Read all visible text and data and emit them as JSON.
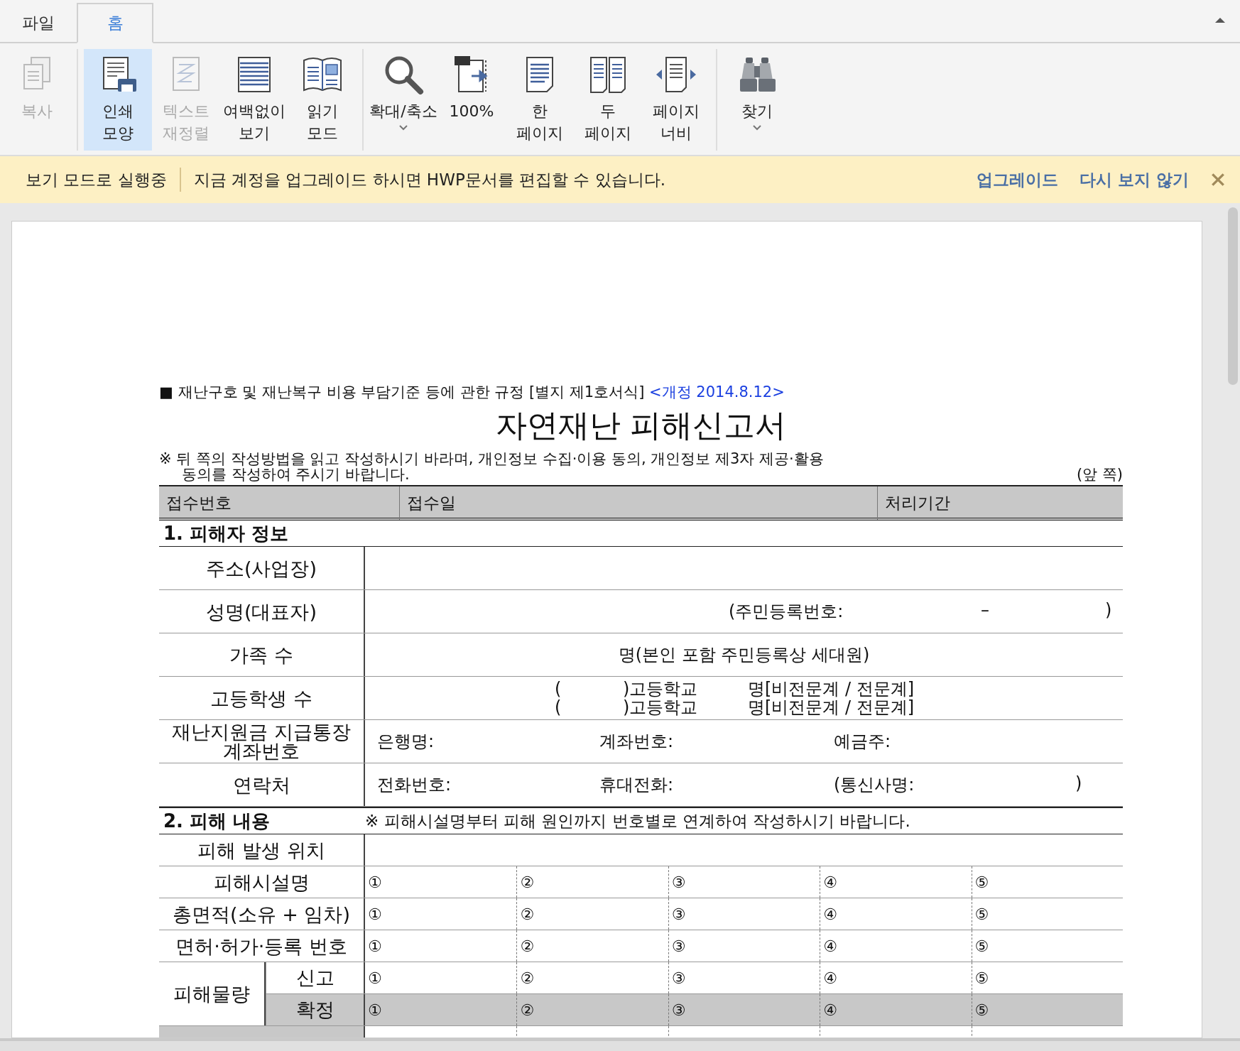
{
  "tabs": [
    {
      "label": "파일",
      "selected": false
    },
    {
      "label": "홈",
      "selected": true
    }
  ],
  "ribbon": {
    "groups": [
      [
        {
          "lines": [
            "복사"
          ],
          "disabled": true,
          "selected": false
        }
      ],
      [
        {
          "lines": [
            "인쇄",
            "모양"
          ],
          "disabled": false,
          "selected": true
        },
        {
          "lines": [
            "텍스트",
            "재정렬"
          ],
          "disabled": true,
          "selected": false
        },
        {
          "lines": [
            "여백없이",
            "보기"
          ],
          "disabled": false,
          "selected": false
        },
        {
          "lines": [
            "읽기",
            "모드"
          ],
          "disabled": false,
          "selected": false
        }
      ],
      [
        {
          "lines": [
            "확대/축소"
          ],
          "disabled": false,
          "selected": false,
          "dropdown": true
        },
        {
          "lines": [
            "100%"
          ],
          "disabled": false,
          "selected": false
        },
        {
          "lines": [
            "한",
            "페이지"
          ],
          "disabled": false,
          "selected": false
        },
        {
          "lines": [
            "두",
            "페이지"
          ],
          "disabled": false,
          "selected": false
        },
        {
          "lines": [
            "페이지",
            "너비"
          ],
          "disabled": false,
          "selected": false
        }
      ],
      [
        {
          "lines": [
            "찾기"
          ],
          "disabled": false,
          "selected": false,
          "dropdown": true
        }
      ]
    ]
  },
  "banner": {
    "mode": "보기 모드로 실행중",
    "message": "지금 계정을 업그레이드 하시면 HWP문서를 편집할 수 있습니다.",
    "links": [
      "업그레이드",
      "다시 보지 않기"
    ]
  },
  "document": {
    "regulation": "■ 재난구호 및 재난복구 비용 부담기준 등에 관한 규정 [별지 제1호서식]",
    "revision": "<개정 2014.8.12>",
    "title": "자연재난 피해신고서",
    "notice_lines": [
      "※ 뒤 쪽의 작성방법을 읽고 작성하시기 바라며, 개인정보 수집·이용 동의, 개인정보 제3자 제공·활용",
      "동의를 작성하여 주시기 바랍니다."
    ],
    "page_side": "(앞 쪽)",
    "receipt_header": [
      "접수번호",
      "접수일",
      "처리기간"
    ],
    "section1": {
      "title": "1. 피해자 정보",
      "rows": [
        {
          "label": "주소(사업장)",
          "kind": "blank"
        },
        {
          "label": "성명(대표자)",
          "kind": "id",
          "fields": [
            "(주민등록번호:",
            "–",
            ")"
          ]
        },
        {
          "label": "가족 수",
          "kind": "centered",
          "fields": [
            "명(본인 포함 주민등록상 세대원)"
          ]
        },
        {
          "label": "고등학생 수",
          "kind": "students",
          "lines": [
            [
              "(",
              ")고등학교",
              "명[비전문계 / 전문계]"
            ],
            [
              "(",
              ")고등학교",
              "명[비전문계 / 전문계]"
            ]
          ]
        },
        {
          "label": "재난지원금 지급통장 계좌번호",
          "kind": "fields",
          "fields": [
            "은행명:",
            "계좌번호:",
            "예금주:"
          ]
        },
        {
          "label": "연락처",
          "kind": "fields",
          "fields": [
            "전화번호:",
            "휴대전화:",
            "(통신사명:",
            ")"
          ]
        }
      ]
    },
    "section2": {
      "title": "2. 피해 내용",
      "note": "※ 피해시설명부터 피해 원인까지 번호별로 연계하여 작성하시기 바랍니다.",
      "rows": [
        {
          "label": "피해 발생 위치",
          "kind": "blank",
          "shaded": false
        },
        {
          "label": "피해시설명",
          "kind": "cells",
          "shaded": false,
          "cells_shaded": false,
          "cells": [
            "①",
            "②",
            "③",
            "④",
            "⑤"
          ]
        },
        {
          "label": "총면적(소유 + 임차)",
          "kind": "cells",
          "shaded": false,
          "cells_shaded": false,
          "cells": [
            "①",
            "②",
            "③",
            "④",
            "⑤"
          ]
        },
        {
          "label": "면허·허가·등록 번호",
          "kind": "cells",
          "shaded": false,
          "cells_shaded": false,
          "cells": [
            "①",
            "②",
            "③",
            "④",
            "⑤"
          ]
        },
        {
          "label": "피해물량",
          "kind": "group",
          "shaded": false,
          "subrows": [
            {
              "label": "신고",
              "shaded": false,
              "cells_shaded": false,
              "cells": [
                "①",
                "②",
                "③",
                "④",
                "⑤"
              ]
            },
            {
              "label": "확정",
              "shaded": true,
              "cells_shaded": true,
              "cells": [
                "①",
                "②",
                "③",
                "④",
                "⑤"
              ]
            }
          ]
        }
      ]
    }
  }
}
